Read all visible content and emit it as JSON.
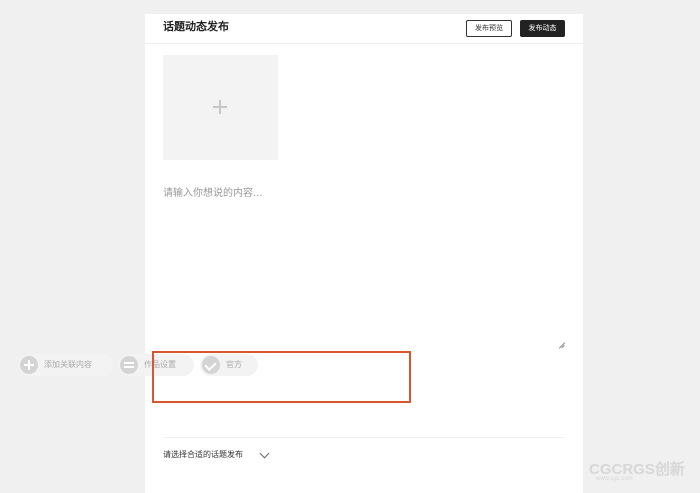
{
  "header": {
    "title": "话题动态发布",
    "preview_label": "发布预览",
    "publish_label": "发布动态"
  },
  "upload": {
    "icon": "plus-icon"
  },
  "editor": {
    "placeholder": "请输入你想说的内容...",
    "value": ""
  },
  "toolbar": {
    "highlight_color": "#d9562c",
    "items": [
      {
        "label": "添加关联内容",
        "icon": "add-circle-icon"
      },
      {
        "label": "作品设置",
        "icon": "settings-icon"
      },
      {
        "label": "官方",
        "icon": "check-icon"
      }
    ]
  },
  "topic": {
    "label": "请选择合适的话题发布",
    "icon": "chevron-down-icon"
  },
  "watermark": {
    "text": "CGCRGS创新",
    "url": "www.cgc.com"
  }
}
